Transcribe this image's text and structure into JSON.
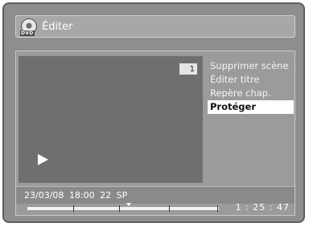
{
  "title_bar": {
    "icon_name": "dvd-disc-icon",
    "icon_label": "DVD",
    "title": "Éditer"
  },
  "preview": {
    "chapter_number": "1",
    "play_icon_name": "play-icon"
  },
  "menu": {
    "items": [
      {
        "label": "Supprimer scène"
      },
      {
        "label": "Éditer titre"
      },
      {
        "label": "Repère chap."
      },
      {
        "label": "Protéger",
        "selected": true
      }
    ]
  },
  "info": {
    "date": "23/03/08",
    "time": "18:00",
    "channel": "22",
    "mode": "SP"
  },
  "timeline": {
    "elapsed": "1 : 25 : 47",
    "playhead_position_fraction": 0.53,
    "chapter_mark_fractions": [
      0.24,
      0.48,
      0.74,
      0.99
    ]
  },
  "colors": {
    "screen_bg": "#8e8e8e",
    "selected_item_bg": "#ffffff",
    "text": "#ffffff"
  }
}
